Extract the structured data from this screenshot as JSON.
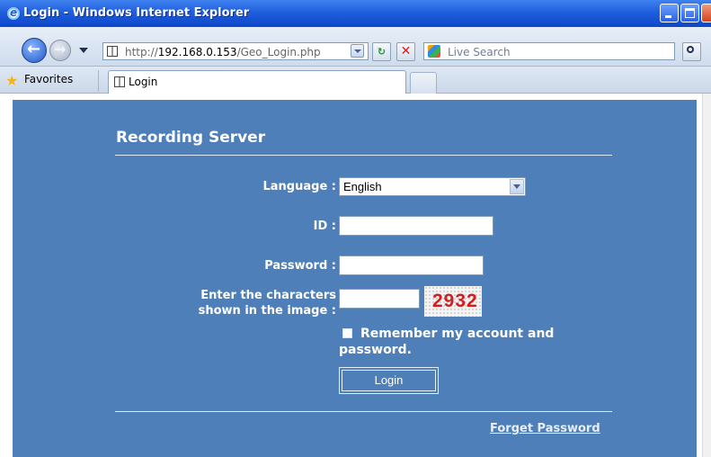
{
  "window": {
    "title": "Login - Windows Internet Explorer",
    "accent": "#1f5fde"
  },
  "addressbar": {
    "url_prefix": "http://",
    "url_host": "192.168.0.153",
    "url_path": "/Geo_Login.php",
    "search_placeholder": "Live Search"
  },
  "favorites_bar": {
    "favorites_label": "Favorites",
    "tab_title": "Login"
  },
  "login": {
    "heading": "Recording Server",
    "language_label": "Language :",
    "language_value": "English",
    "id_label": "ID :",
    "id_value": "",
    "password_label": "Password :",
    "password_value": "",
    "captcha_label_line1": "Enter the characters",
    "captcha_label_line2": "shown in the image :",
    "captcha_value": "",
    "captcha_image_text": "2932",
    "remember_label": "Remember my account and password.",
    "remember_checked": false,
    "login_button": "Login",
    "forget_password_link": "Forget Password",
    "panel_color": "#4f7fb8"
  }
}
